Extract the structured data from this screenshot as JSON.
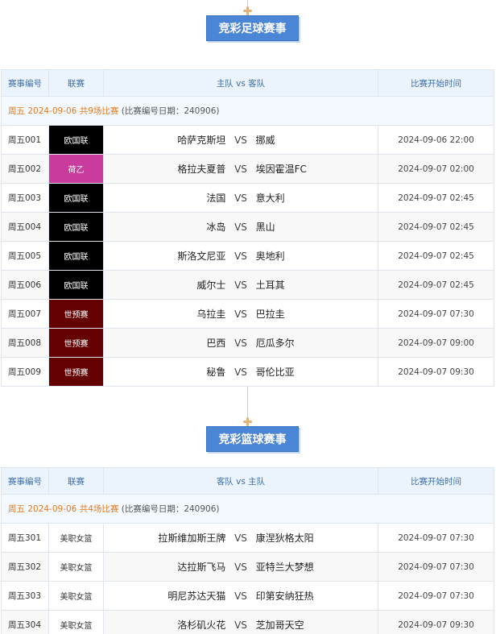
{
  "football": {
    "title": "竞彩足球赛事",
    "headers": {
      "num": "赛事编号",
      "league": "联赛",
      "match": "主队 vs 客队",
      "time": "比赛开始时间"
    },
    "date_row": {
      "highlight": "周五 2024-09-06 共9场比赛",
      "note": " (比赛编号日期：240906)"
    },
    "vs_label": "VS",
    "rows": [
      {
        "num": "周五001",
        "league": "欧国联",
        "league_color": "#000000",
        "home": "哈萨克斯坦",
        "away": "挪威",
        "time": "2024-09-06 22:00"
      },
      {
        "num": "周五002",
        "league": "荷乙",
        "league_color": "#c93b9d",
        "home": "格拉夫夏普",
        "away": "埃因霍温FC",
        "time": "2024-09-07 02:00"
      },
      {
        "num": "周五003",
        "league": "欧国联",
        "league_color": "#000000",
        "home": "法国",
        "away": "意大利",
        "time": "2024-09-07 02:45"
      },
      {
        "num": "周五004",
        "league": "欧国联",
        "league_color": "#000000",
        "home": "冰岛",
        "away": "黑山",
        "time": "2024-09-07 02:45"
      },
      {
        "num": "周五005",
        "league": "欧国联",
        "league_color": "#000000",
        "home": "斯洛文尼亚",
        "away": "奥地利",
        "time": "2024-09-07 02:45"
      },
      {
        "num": "周五006",
        "league": "欧国联",
        "league_color": "#000000",
        "home": "威尔士",
        "away": "土耳其",
        "time": "2024-09-07 02:45"
      },
      {
        "num": "周五007",
        "league": "世预赛",
        "league_color": "#650000",
        "home": "乌拉圭",
        "away": "巴拉圭",
        "time": "2024-09-07 07:30"
      },
      {
        "num": "周五008",
        "league": "世预赛",
        "league_color": "#650000",
        "home": "巴西",
        "away": "厄瓜多尔",
        "time": "2024-09-07 09:00"
      },
      {
        "num": "周五009",
        "league": "世预赛",
        "league_color": "#650000",
        "home": "秘鲁",
        "away": "哥伦比亚",
        "time": "2024-09-07 09:30"
      }
    ]
  },
  "basketball": {
    "title": "竞彩篮球赛事",
    "headers": {
      "num": "赛事编号",
      "league": "联赛",
      "match": "客队 vs 主队",
      "time": "比赛开始时间"
    },
    "date_row": {
      "highlight": "周五 2024-09-06 共4场比赛",
      "note": " (比赛编号日期：240906)"
    },
    "vs_label": "VS",
    "rows": [
      {
        "num": "周五301",
        "league": "美职女篮",
        "home": "拉斯维加斯王牌",
        "away": "康涅狄格太阳",
        "time": "2024-09-07 07:30"
      },
      {
        "num": "周五302",
        "league": "美职女篮",
        "home": "达拉斯飞马",
        "away": "亚特兰大梦想",
        "time": "2024-09-07 07:30"
      },
      {
        "num": "周五303",
        "league": "美职女篮",
        "home": "明尼苏达天猫",
        "away": "印第安纳狂热",
        "time": "2024-09-07 07:30"
      },
      {
        "num": "周五304",
        "league": "美职女篮",
        "home": "洛杉矶火花",
        "away": "芝加哥天空",
        "time": "2024-09-07 09:30"
      }
    ]
  }
}
